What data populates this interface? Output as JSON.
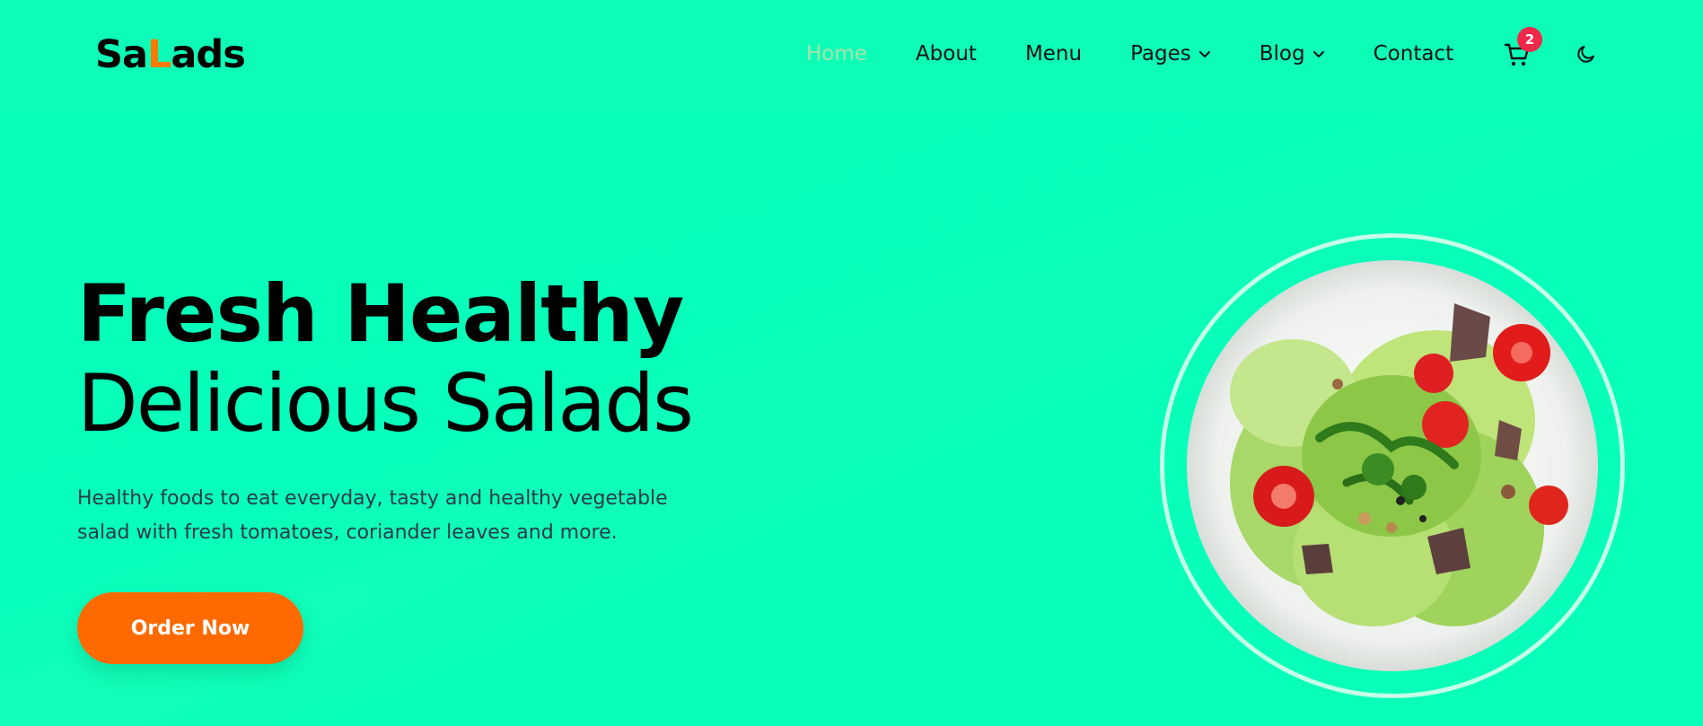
{
  "logo": {
    "part1": "Sa",
    "accent": "L",
    "part2": "ads"
  },
  "nav": {
    "items": [
      {
        "label": "Home",
        "active": true
      },
      {
        "label": "About"
      },
      {
        "label": "Menu"
      },
      {
        "label": "Pages",
        "dropdown": true
      },
      {
        "label": "Blog",
        "dropdown": true
      },
      {
        "label": "Contact"
      }
    ],
    "cart_count": "2"
  },
  "hero": {
    "title_line1": "Fresh Healthy",
    "title_line2": "Delicious Salads",
    "description": "Healthy foods to eat everyday, tasty and healthy vegetable salad with fresh tomatoes, coriander leaves and more.",
    "cta_label": "Order Now"
  },
  "colors": {
    "background": "#07ffb9",
    "accent": "#ff6a00",
    "badge": "#f02849",
    "active_nav": "#a9e3a9"
  },
  "icons": [
    "cart-icon",
    "moon-icon",
    "chevron-down-icon"
  ]
}
